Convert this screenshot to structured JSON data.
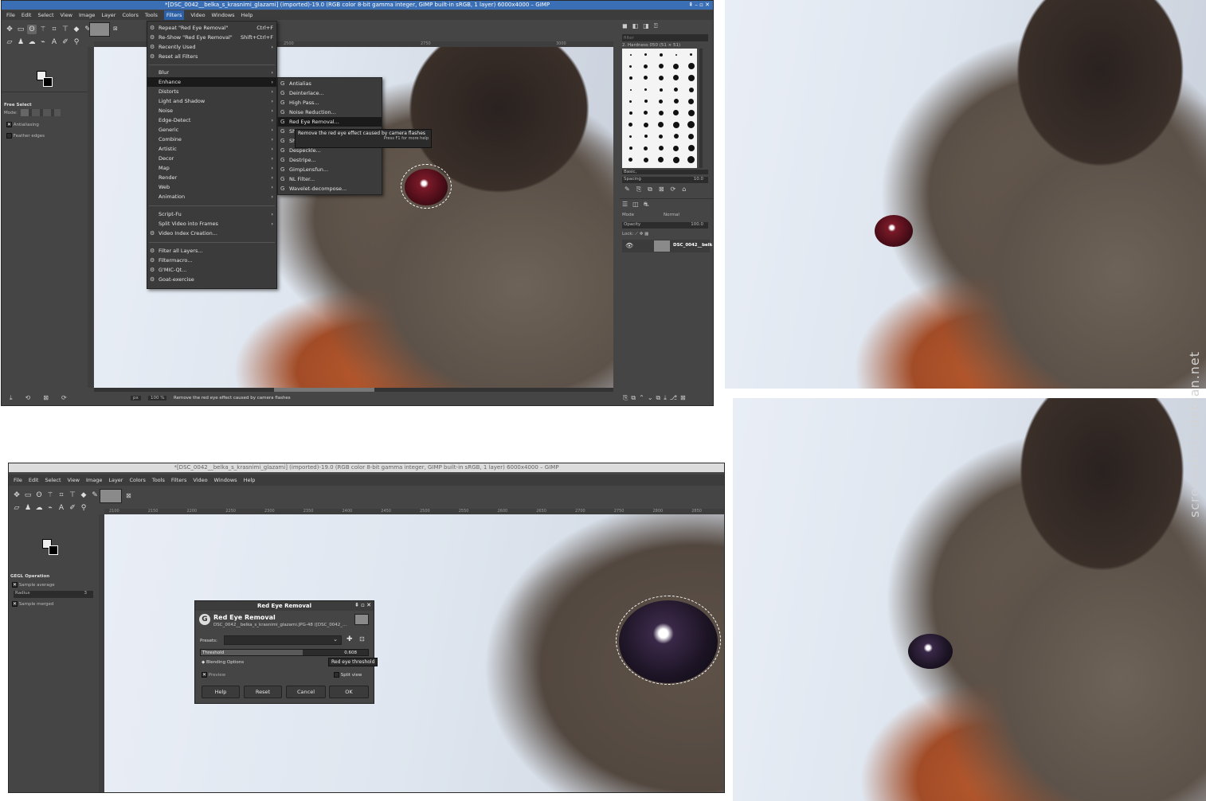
{
  "top_window": {
    "title": "*[DSC_0042__belka_s_krasnimi_glazami] (imported)-19.0 (RGB color 8-bit gamma integer, GIMP built-in sRGB, 1 layer) 6000x4000 – GIMP",
    "menubar": [
      "File",
      "Edit",
      "Select",
      "View",
      "Image",
      "Layer",
      "Colors",
      "Tools",
      "Filters",
      "Video",
      "Windows",
      "Help"
    ],
    "active_menu": "Filters",
    "tool_options_title": "Free Select",
    "mode_label": "Mode:",
    "antialiasing_label": "Antialiasing",
    "feather_label": "Feather edges",
    "zoom_unit": "px",
    "zoom_value": "100 %",
    "status_text": "Remove the red eye effect caused by camera flashes",
    "filters_menu": {
      "top_items": [
        {
          "label": "Repeat \"Red Eye Removal\"",
          "accel": "Ctrl+F"
        },
        {
          "label": "Re-Show \"Red Eye Removal\"",
          "accel": "Shift+Ctrl+F"
        },
        {
          "label": "Recently Used",
          "accel": ""
        },
        {
          "label": "Reset all Filters",
          "accel": ""
        }
      ],
      "group_items": [
        "Blur",
        "Enhance",
        "Distorts",
        "Light and Shadow",
        "Noise",
        "Edge-Detect",
        "Generic",
        "Combine",
        "Artistic",
        "Decor",
        "Map",
        "Render",
        "Web",
        "Animation"
      ],
      "script_items": [
        "Script-Fu",
        "Split Video into Frames",
        "Video Index Creation..."
      ],
      "plugin_items": [
        "Filter all Layers...",
        "Filtermacro...",
        "G'MIC-Qt...",
        "Goat-exercise"
      ]
    },
    "enhance_submenu": [
      "Antialias",
      "Deinterlace...",
      "High Pass...",
      "Noise Reduction...",
      "Red Eye Removal...",
      "Sharpen...",
      "Sharpen (Unsharp Mask)...",
      "Despeckle...",
      "Destripe...",
      "GimpLensfun...",
      "NL Filter...",
      "Wavelet-decompose..."
    ],
    "tooltip": "Remove the red eye effect caused by camera flashes",
    "tooltip_help": "Press F1 for more help",
    "brushes": {
      "filter_placeholder": "filter",
      "brush_name": "2. Hardness 050 (51 × 51)",
      "preset": "Basic,",
      "spacing_label": "Spacing",
      "spacing_value": "10.0"
    },
    "layers": {
      "mode_label": "Mode",
      "mode_value": "Normal",
      "opacity_label": "Opacity",
      "opacity_value": "100.0",
      "lock_label": "Lock:",
      "layer_name": "DSC_0042__belk"
    },
    "ruler_marks": [
      "2500",
      "2750",
      "3000"
    ]
  },
  "bottom_window": {
    "title": "*[DSC_0042__belka_s_krasnimi_glazami] (imported)-19.0 (RGB color 8-bit gamma integer, GIMP built-in sRGB, 1 layer) 6000x4000 – GIMP",
    "menubar": [
      "File",
      "Edit",
      "Select",
      "View",
      "Image",
      "Layer",
      "Colors",
      "Tools",
      "Filters",
      "Video",
      "Windows",
      "Help"
    ],
    "tool_options_title": "GEGL Operation",
    "sample_average_label": "Sample average",
    "radius_label": "Radius",
    "radius_value": "3",
    "sample_merged_label": "Sample merged",
    "ruler_marks": [
      "2100",
      "2150",
      "2200",
      "2250",
      "2300",
      "2350",
      "2400",
      "2450",
      "2500",
      "2550",
      "2600",
      "2650",
      "2700",
      "2750",
      "2800",
      "2850"
    ]
  },
  "dialog": {
    "window_title": "Red Eye Removal",
    "heading": "Red Eye Removal",
    "subheading": "DSC_0042__belka_s_krasnimi_glazami.JPG-48 ([DSC_0042_...",
    "presets_label": "Presets:",
    "threshold_label": "Threshold",
    "threshold_value": "0.608",
    "threshold_fraction": 0.608,
    "threshold_tooltip": "Red eye threshold",
    "blending_label": "Blending Options",
    "preview_label": "Preview",
    "split_view_label": "Split view",
    "buttons": [
      "Help",
      "Reset",
      "Cancel",
      "OK"
    ]
  },
  "watermark": "screenshots.debian.net"
}
